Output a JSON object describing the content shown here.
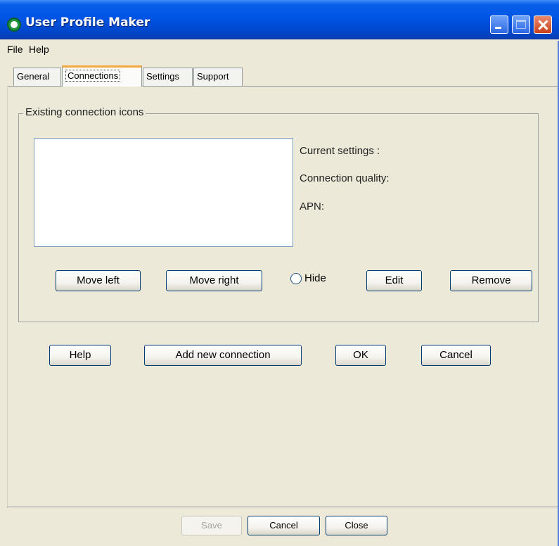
{
  "window": {
    "title": "User Profile Maker"
  },
  "menu": {
    "file": "File",
    "help": "Help"
  },
  "tabs": [
    {
      "label": "General"
    },
    {
      "label": "Connections",
      "active": true
    },
    {
      "label": "Settings"
    },
    {
      "label": "Support"
    }
  ],
  "group": {
    "title": "Existing connection icons",
    "current_settings": "Current settings :",
    "connection_quality": "Connection quality:",
    "apn": "APN:",
    "move_left": "Move left",
    "move_right": "Move right",
    "hide": "Hide",
    "edit": "Edit",
    "remove": "Remove"
  },
  "actions": {
    "help": "Help",
    "add_new_connection": "Add new connection",
    "ok": "OK",
    "cancel": "Cancel"
  },
  "footer": {
    "save": "Save",
    "cancel": "Cancel",
    "close": "Close"
  },
  "colors": {
    "titlebar": "#0055E5",
    "window_bg": "#ECE9D8",
    "active_tab_accent": "#F2A93B",
    "close_button": "#C8411A"
  }
}
